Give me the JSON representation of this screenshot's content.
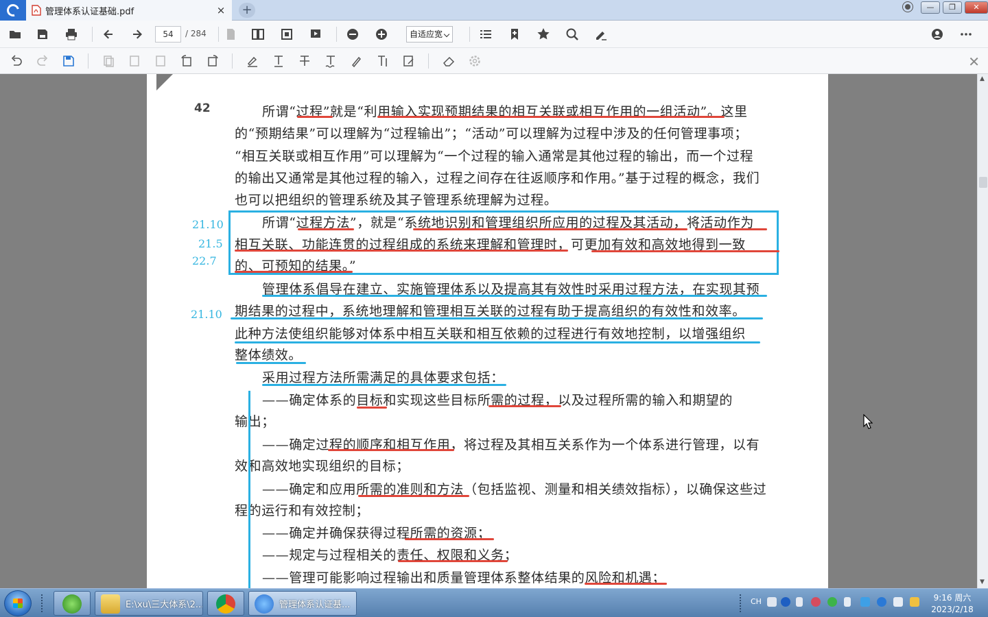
{
  "window": {
    "tab_title": "管理体系认证基础.pdf",
    "tab_close": "×",
    "tab_add": "+",
    "minimize": "—",
    "restore": "❐",
    "close": "✕"
  },
  "toolbar": {
    "page_current": "54",
    "page_total": "/ 284",
    "zoom_mode": "自适应宽"
  },
  "document": {
    "page_number": "42",
    "lines": [
      "所谓“过程”就是“利用输入实现预期结果的相互关联或相互作用的一组活动”。这里",
      "的“预期结果”可以理解为“过程输出”；“活动”可以理解为过程中涉及的任何管理事项；",
      "“相互关联或相互作用”可以理解为“一个过程的输入通常是其他过程的输出，而一个过程",
      "的输出又通常是其他过程的输入，过程之间存在往返顺序和作用。”基于过程的概念，我们",
      "也可以把组织的管理系统及其子管理系统理解为过程。",
      "所谓“过程方法”，就是“系统地识别和管理组织所应用的过程及其活动，将活动作为",
      "相互关联、功能连贯的过程组成的系统来理解和管理时，可更加有效和高效地得到一致",
      "的、可预知的结果。”",
      "管理体系倡导在建立、实施管理体系以及提高其有效性时采用过程方法，在实现其预",
      "期结果的过程中，系统地理解和管理相互关联的过程有助于提高组织的有效性和效率。",
      "此种方法使组织能够对体系中相互关联和相互依赖的过程进行有效地控制，以增强组织",
      "整体绩效。",
      "采用过程方法所需满足的具体要求包括：",
      "——确定体系的目标和实现这些目标所需的过程，以及过程所需的输入和期望的",
      "输出；",
      "——确定过程的顺序和相互作用，将过程及其相互关系作为一个体系进行管理，以有",
      "效和高效地实现组织的目标；",
      "——确定和应用所需的准则和方法（包括监视、测量和相关绩效指标），以确保这些过",
      "程的运行和有效控制；",
      "——确定并确保获得过程所需的资源；",
      "——规定与过程相关的责任、权限和义务；",
      "——管理可能影响过程输出和质量管理体系整体结果的风险和机遇；"
    ],
    "margin_notes": [
      "21.10",
      "21.5",
      "22.7",
      "21.10"
    ]
  },
  "taskbar": {
    "explorer_label": "E:\\xu\\三大体系\\2...",
    "reader_label": "管理体系认证基...",
    "lang": "CH",
    "time": "9:16 周六",
    "date": "2023/2/18"
  },
  "colors": {
    "annotation_red": "#e0463a",
    "annotation_blue": "#2ab0e2"
  }
}
